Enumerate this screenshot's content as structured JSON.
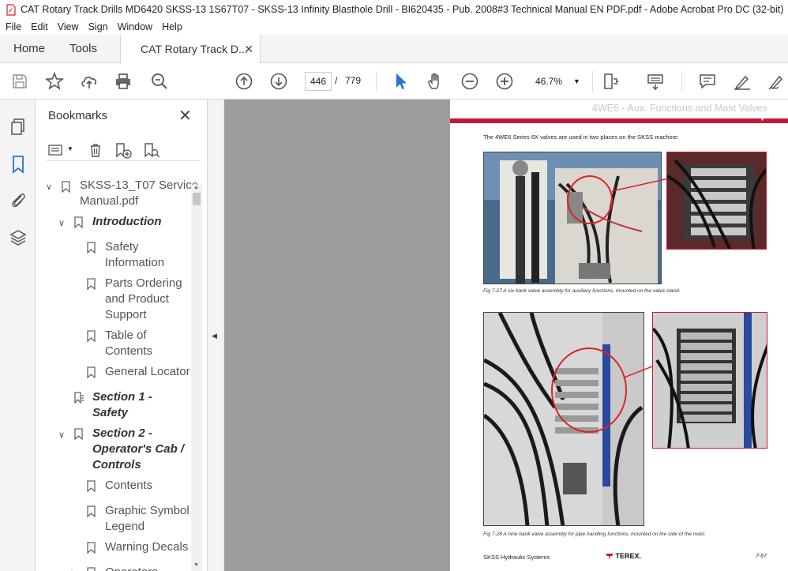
{
  "window": {
    "title": "CAT Rotary Track Drills MD6420 SKSS-13 1S67T07 - SKSS-13 Infinity Blasthole Drill - BI620435 - Pub. 2008#3 Technical Manual EN PDF.pdf - Adobe Acrobat Pro DC (32-bit)"
  },
  "menu": [
    "File",
    "Edit",
    "View",
    "Sign",
    "Window",
    "Help"
  ],
  "tabs": {
    "home": "Home",
    "tools": "Tools",
    "document": "CAT Rotary Track D...",
    "close": "✕"
  },
  "toolbar": {
    "page_current": "446",
    "page_separator": "/",
    "page_total": "779",
    "zoom": "46.7%"
  },
  "bookmarks": {
    "title": "Bookmarks",
    "close": "✕",
    "items": [
      {
        "line1": "SKSS-13_T07 Service",
        "line2": "Manual.pdf"
      },
      {
        "line1": "Introduction"
      },
      {
        "line1": "Safety",
        "line2": "Information"
      },
      {
        "line1": "Parts Ordering",
        "line2": "and Product",
        "line3": "Support"
      },
      {
        "line1": "Table of",
        "line2": "Contents"
      },
      {
        "line1": "General Locator"
      },
      {
        "line1": "Section 1 -",
        "line2": "Safety"
      },
      {
        "line1": "Section 2 -",
        "line2": "Operator's Cab /",
        "line3": "Controls"
      },
      {
        "line1": "Contents"
      },
      {
        "line1": "Graphic Symbol",
        "line2": "Legend"
      },
      {
        "line1": "Warning Decals"
      },
      {
        "line1": "Operators"
      }
    ]
  },
  "page": {
    "header": "4WE6 - Aux. Functions and Mast Valves",
    "intro": "The 4WE6 Series 6X valves are used in two places on the SKSS machine:",
    "fig27_caption": "Fig 7-27    A six bank valve assembly for auxiliary functions, mounted on the valve stand.",
    "fig28_caption": "Fig 7-28    A nine bank valve assembly for pipe handling functions, mounted on the side of the mast.",
    "footer_left": "SKSS Hydraulic Systems",
    "footer_logo": "TEREX.",
    "footer_page": "7-67"
  },
  "colors": {
    "accent": "#c41a3b",
    "acrobat_red": "#d4202f"
  }
}
